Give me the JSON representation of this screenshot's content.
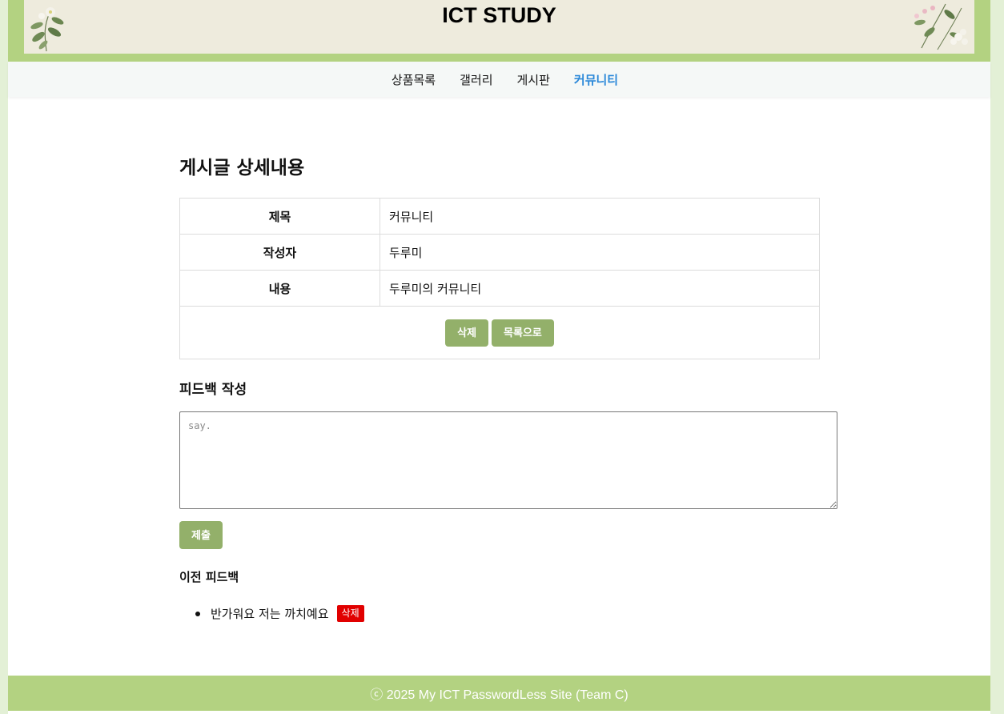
{
  "header": {
    "title": "ICT STUDY"
  },
  "nav": {
    "items": [
      {
        "label": "상품목록"
      },
      {
        "label": "갤러리"
      },
      {
        "label": "게시판"
      },
      {
        "label": "커뮤니티"
      }
    ],
    "active_index": 3
  },
  "post": {
    "page_title": "게시글 상세내용",
    "rows": [
      {
        "label": "제목",
        "value": "커뮤니티"
      },
      {
        "label": "작성자",
        "value": "두루미"
      },
      {
        "label": "내용",
        "value": "두루미의 커뮤니티"
      }
    ],
    "delete_label": "삭제",
    "list_label": "목록으로"
  },
  "feedback": {
    "heading": "피드백 작성",
    "placeholder": "say.",
    "value": "",
    "submit_label": "제출",
    "previous_heading": "이전 피드백",
    "items": [
      {
        "text": "반가워요 저는 까치예요",
        "delete_label": "삭제"
      }
    ]
  },
  "footer": {
    "text": "ⓒ 2025 My ICT PasswordLess Site (Team C)"
  },
  "colors": {
    "header_band": "#b3d281",
    "header_inner": "#eeebdd",
    "nav_active": "#2a88d9",
    "button": "#93b06a",
    "delete_badge": "#e10000",
    "body_bg": "#e3f0d6"
  }
}
